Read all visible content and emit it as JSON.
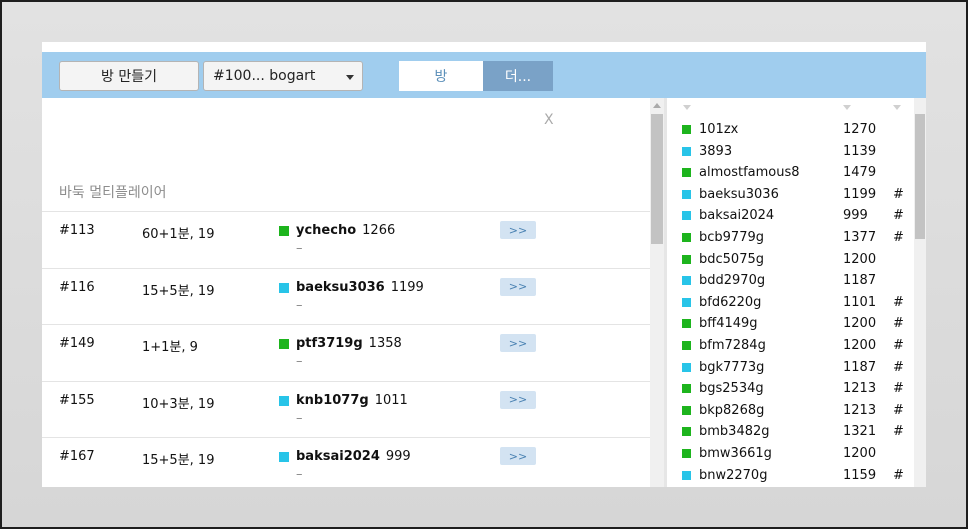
{
  "colors": {
    "topbar": "#a0cdee",
    "status_green": "#1db41d",
    "status_cyan": "#28c4e8",
    "tab_active_text": "#5b8fb9",
    "tab_inactive_bg": "#7aa2c7"
  },
  "toolbar": {
    "create_room_label": "방 만들기",
    "room_select_value": "#100... bogart",
    "tab_room_label": "방",
    "tab_more_label": "더..."
  },
  "panel": {
    "close_label": "X",
    "title": "바둑 멀티플레이어"
  },
  "games": [
    {
      "id": "#113",
      "time": "60+1분, 19",
      "status": "green",
      "player": "ychecho",
      "rank": "1266",
      "opponent": "–",
      "join_label": ">>"
    },
    {
      "id": "#116",
      "time": "15+5분, 19",
      "status": "cyan",
      "player": "baeksu3036",
      "rank": "1199",
      "opponent": "–",
      "join_label": ">>"
    },
    {
      "id": "#149",
      "time": "1+1분, 9",
      "status": "green",
      "player": "ptf3719g",
      "rank": "1358",
      "opponent": "–",
      "join_label": ">>"
    },
    {
      "id": "#155",
      "time": "10+3분, 19",
      "status": "cyan",
      "player": "knb1077g",
      "rank": "1011",
      "opponent": "–",
      "join_label": ">>"
    },
    {
      "id": "#167",
      "time": "15+5분, 19",
      "status": "cyan",
      "player": "baksai2024",
      "rank": "999",
      "opponent": "–",
      "join_label": ">>"
    }
  ],
  "users": [
    {
      "name": "101zx",
      "rank": "1270",
      "flag": "",
      "status": "green"
    },
    {
      "name": "3893",
      "rank": "1139",
      "flag": "",
      "status": "cyan"
    },
    {
      "name": "almostfamous8",
      "rank": "1479",
      "flag": "",
      "status": "green"
    },
    {
      "name": "baeksu3036",
      "rank": "1199",
      "flag": "#",
      "status": "cyan"
    },
    {
      "name": "baksai2024",
      "rank": "999",
      "flag": "#",
      "status": "cyan"
    },
    {
      "name": "bcb9779g",
      "rank": "1377",
      "flag": "#",
      "status": "green"
    },
    {
      "name": "bdc5075g",
      "rank": "1200",
      "flag": "",
      "status": "green"
    },
    {
      "name": "bdd2970g",
      "rank": "1187",
      "flag": "",
      "status": "cyan"
    },
    {
      "name": "bfd6220g",
      "rank": "1101",
      "flag": "#",
      "status": "cyan"
    },
    {
      "name": "bff4149g",
      "rank": "1200",
      "flag": "#",
      "status": "green"
    },
    {
      "name": "bfm7284g",
      "rank": "1200",
      "flag": "#",
      "status": "green"
    },
    {
      "name": "bgk7773g",
      "rank": "1187",
      "flag": "#",
      "status": "cyan"
    },
    {
      "name": "bgs2534g",
      "rank": "1213",
      "flag": "#",
      "status": "green"
    },
    {
      "name": "bkp8268g",
      "rank": "1213",
      "flag": "#",
      "status": "green"
    },
    {
      "name": "bmb3482g",
      "rank": "1321",
      "flag": "#",
      "status": "green"
    },
    {
      "name": "bmw3661g",
      "rank": "1200",
      "flag": "",
      "status": "green"
    },
    {
      "name": "bnw2270g",
      "rank": "1159",
      "flag": "#",
      "status": "cyan"
    }
  ]
}
